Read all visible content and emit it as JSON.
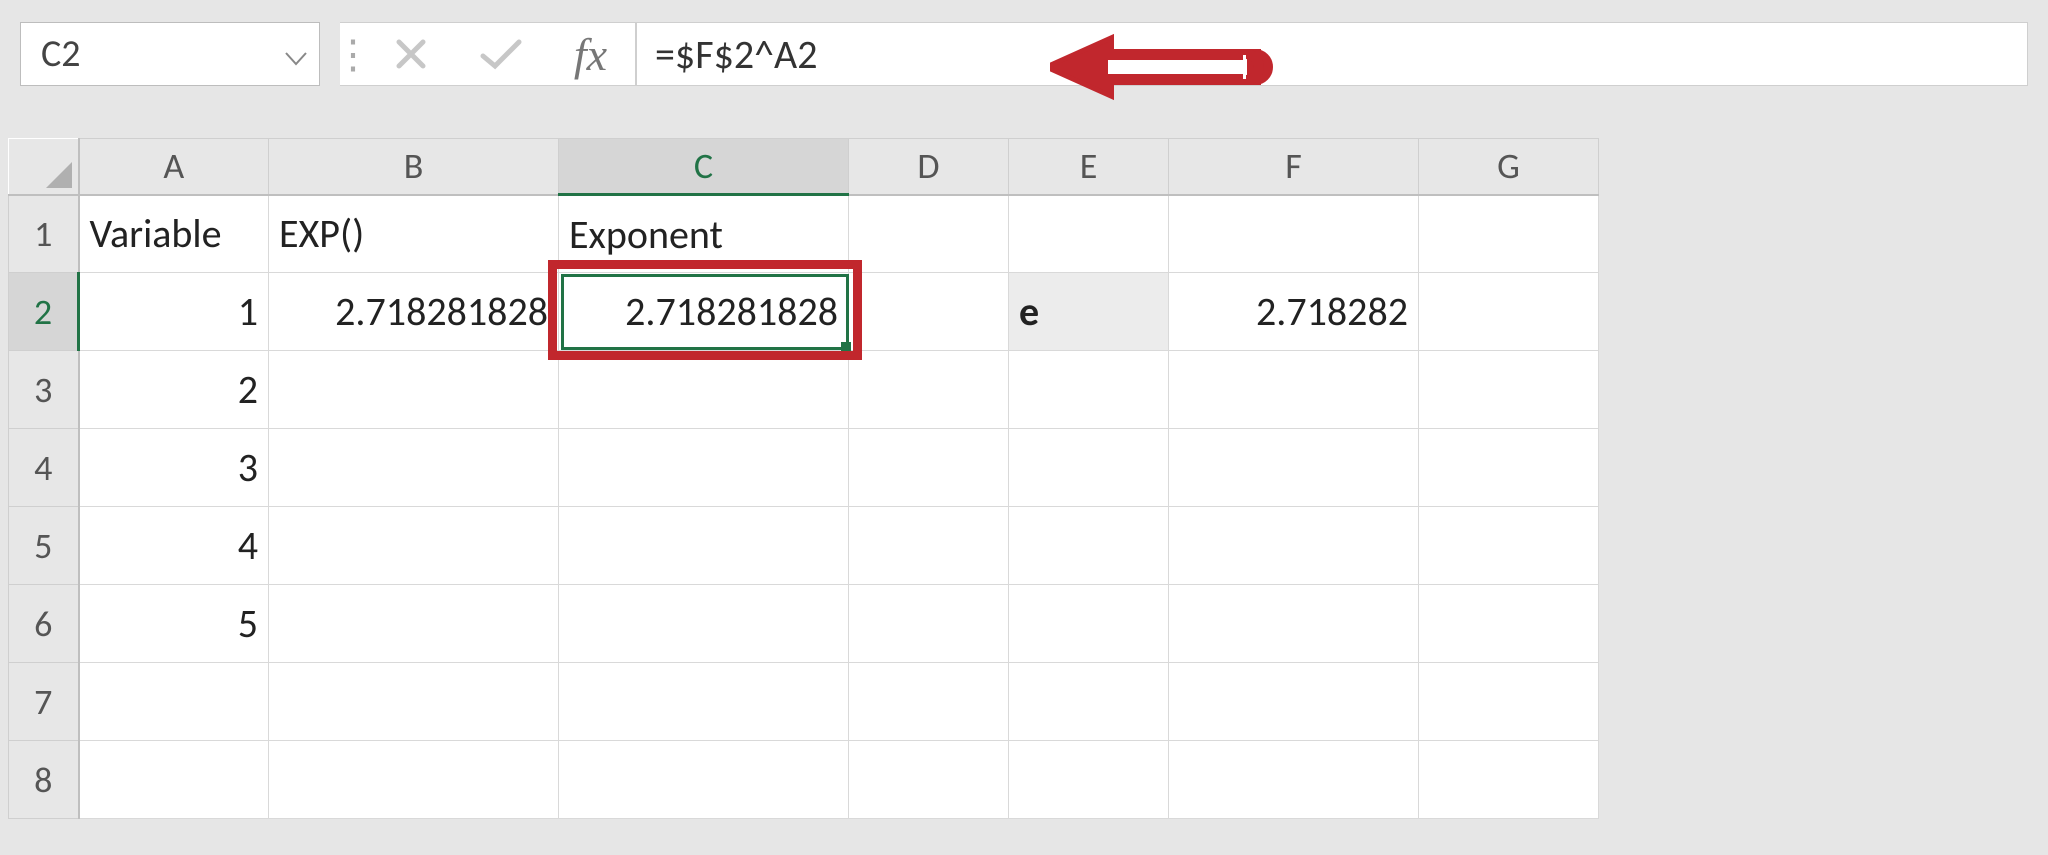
{
  "formula_bar": {
    "cell_ref": "C2",
    "formula": "=$F$2^A2",
    "fx_label": "fx"
  },
  "columns": [
    "A",
    "B",
    "C",
    "D",
    "E",
    "F",
    "G"
  ],
  "rows": [
    "1",
    "2",
    "3",
    "4",
    "5",
    "6",
    "7",
    "8"
  ],
  "selected_column": "C",
  "selected_row": "2",
  "cells": {
    "A1": "Variable",
    "B1": "EXP()",
    "C1": "Exponent",
    "A2": "1",
    "B2": "2.718281828",
    "C2": "2.718281828",
    "E2": "e",
    "F2": "2.718282",
    "A3": "2",
    "A4": "3",
    "A5": "4",
    "A6": "5"
  }
}
